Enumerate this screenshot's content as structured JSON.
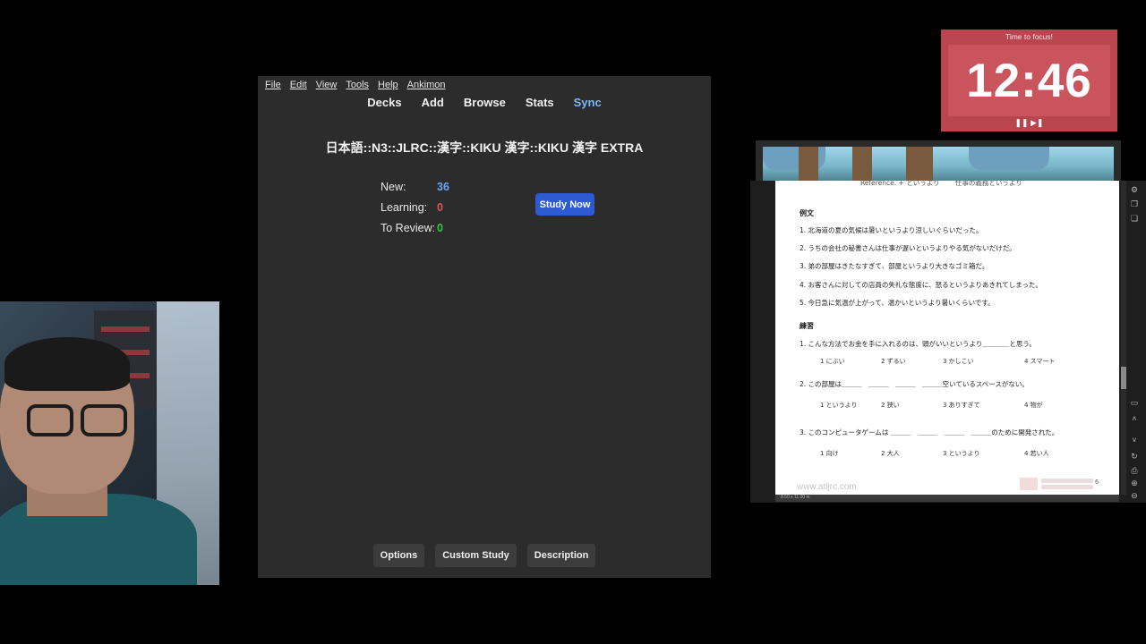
{
  "anki": {
    "menu": [
      "File",
      "Edit",
      "View",
      "Tools",
      "Help",
      "Ankimon"
    ],
    "toolbar": {
      "decks": "Decks",
      "add": "Add",
      "browse": "Browse",
      "stats": "Stats",
      "sync": "Sync"
    },
    "deck_title": "日本語::N3::JLRC::漢字::KIKU 漢字::KIKU 漢字 EXTRA",
    "stats": {
      "new_label": "New:",
      "new_value": "36",
      "new_color": "#6aa6f0",
      "learning_label": "Learning:",
      "learning_value": "0",
      "learning_color": "#e05555",
      "review_label": "To Review:",
      "review_value": "0",
      "review_color": "#35c24b"
    },
    "study_now": "Study Now",
    "bottom": {
      "options": "Options",
      "custom_study": "Custom Study",
      "description": "Description"
    }
  },
  "timer": {
    "caption": "Time to focus!",
    "time": "12:46",
    "controls": "❚❚ ▶❚"
  },
  "pdf": {
    "header_text": "Reference. + というより　　 仕事の義務というより",
    "section1": "例文",
    "ex1": "1. 北海道の夏の気候は暑いというより涼しいぐらいだった。",
    "ex2": "2. うちの会社の秘書さんは仕事が遅いというよりやる気がないだけだ。",
    "ex3": "3. 弟の部屋はきたなすぎて、部屋というより大きなゴミ箱だ。",
    "ex4": "4. お客さんに対しての店員の失礼な態度に、怒るというよりあきれてしまった。",
    "ex5": "5. 今日急に気温が上がって、温かいというより暑いくらいです。",
    "section2": "練習",
    "q1": "1. こんな方法でお金を手に入れるのは、頭がいいというより＿＿＿＿と思う。",
    "q1_opts": [
      "1 にぶい",
      "2 ずるい",
      "3 かしこい",
      "4 スマート"
    ],
    "q2": "2. この部屋は＿＿＿　＿＿＿　＿＿＿　＿＿＿空いているスペースがない。",
    "q2_opts": [
      "1 というより",
      "2 狭い",
      "3 ありすぎて",
      "4 物が"
    ],
    "q3": "3. このコンピュータゲームは ＿＿＿　＿＿＿　＿＿＿　＿＿＿のために開発された。",
    "q3_opts": [
      "1 向け",
      "2 大人",
      "3 というより",
      "4 若い人"
    ],
    "footer": "www.atljrc.com",
    "page_number": "6",
    "page_size": "8.50 x 11.00 in"
  },
  "icons": {
    "side": [
      "gear-icon",
      "bookmark-icon",
      "copy-icon",
      "page-icon",
      "chevron-up-icon",
      "chevron-down-icon",
      "rotate-icon",
      "print-icon",
      "zoom-in-icon",
      "zoom-out-icon"
    ]
  }
}
